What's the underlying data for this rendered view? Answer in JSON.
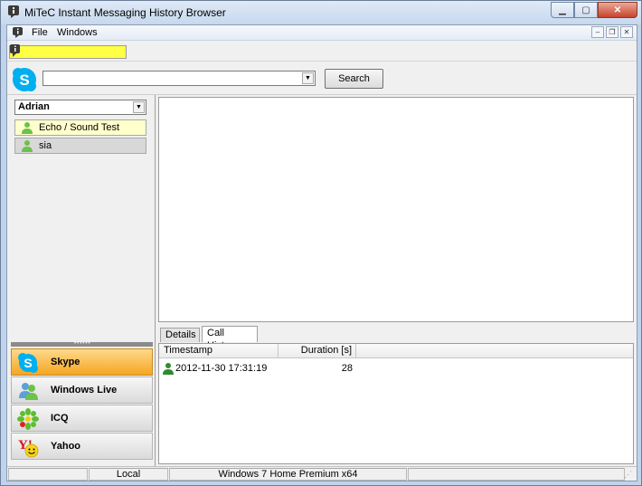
{
  "window": {
    "title": "MiTeC Instant Messaging History Browser"
  },
  "menu": {
    "items": [
      "File",
      "Windows"
    ]
  },
  "search": {
    "placeholder": "",
    "value": "",
    "button_label": "Search"
  },
  "accounts": {
    "selected": "Adrian"
  },
  "contacts": [
    {
      "name": "Echo / Sound Test Service",
      "highlighted": true
    },
    {
      "name": "sia",
      "highlighted": false
    }
  ],
  "networks": [
    {
      "label": "Skype",
      "icon": "skype-icon",
      "active": true
    },
    {
      "label": "Windows Live",
      "icon": "windows-live-icon",
      "active": false
    },
    {
      "label": "ICQ",
      "icon": "icq-icon",
      "active": false
    },
    {
      "label": "Yahoo",
      "icon": "yahoo-icon",
      "active": false
    }
  ],
  "tabs": [
    {
      "label": "Details",
      "active": false
    },
    {
      "label": "Call History",
      "active": true
    }
  ],
  "call_history": {
    "columns": [
      "Timestamp",
      "Duration [s]"
    ],
    "rows": [
      {
        "timestamp": "2012-11-30 17:31:19",
        "duration": "28"
      }
    ]
  },
  "status": {
    "panel1": "",
    "panel2": "Local",
    "panel3": "Windows 7 Home Premium x64",
    "panel4": ""
  },
  "colors": {
    "accent": "#f5a623",
    "highlight": "#ffff44",
    "skype_blue": "#00aff0"
  }
}
